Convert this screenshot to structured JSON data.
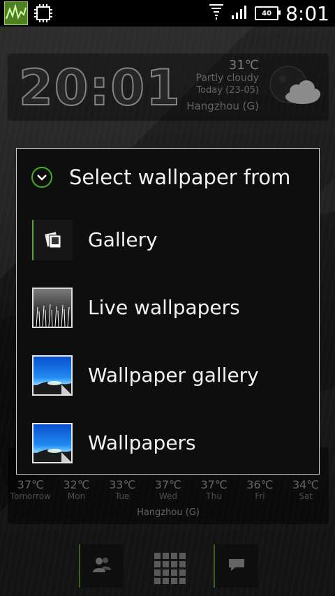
{
  "status_bar": {
    "time": "8:01",
    "battery_level": "40",
    "icons": [
      "activity-chart-icon",
      "chip-icon",
      "wifi-icon",
      "signal-icon",
      "battery-icon"
    ]
  },
  "clock_widget": {
    "time": "20:01",
    "temperature": "31℃",
    "condition": "Partly cloudy",
    "date": "Today  (23-05)",
    "city": "Hangzhou (G)",
    "weather_icon": "moon-cloud-icon"
  },
  "dialog": {
    "title": "Select wallpaper from",
    "header_icon": "chevron-down-circle-icon",
    "accent_color": "#47b01d",
    "items": [
      {
        "label": "Gallery",
        "icon": "gallery-icon"
      },
      {
        "label": "Live wallpapers",
        "icon": "live-wallpapers-icon"
      },
      {
        "label": "Wallpaper gallery",
        "icon": "wallpaper-gallery-icon"
      },
      {
        "label": "Wallpapers",
        "icon": "wallpapers-icon"
      }
    ]
  },
  "forecast": {
    "city": "Hangzhou (G)",
    "days": [
      {
        "temp": "37℃",
        "day": "Tomorrow"
      },
      {
        "temp": "32℃",
        "day": "Mon"
      },
      {
        "temp": "33℃",
        "day": "Tue"
      },
      {
        "temp": "37℃",
        "day": "Wed"
      },
      {
        "temp": "37℃",
        "day": "Thu"
      },
      {
        "temp": "36℃",
        "day": "Fri"
      },
      {
        "temp": "34℃",
        "day": "Sat"
      }
    ]
  },
  "dock": {
    "items": [
      "contacts-icon",
      "all-apps-icon",
      "messages-icon"
    ]
  }
}
